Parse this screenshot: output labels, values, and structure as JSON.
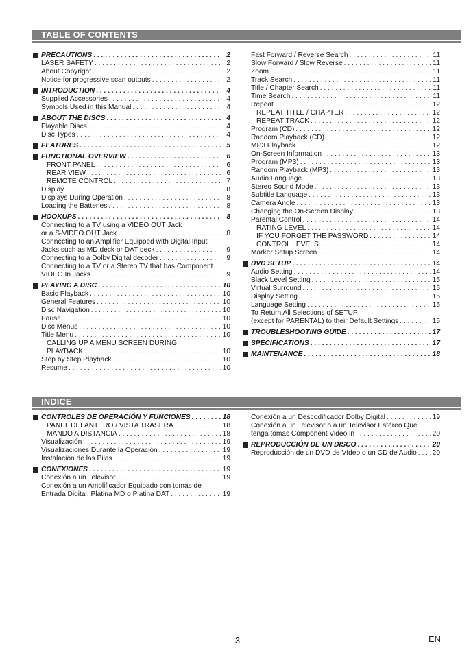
{
  "toc": {
    "heading": "TABLE OF CONTENTS",
    "left": [
      {
        "title": "PRECAUTIONS",
        "page": "2",
        "type": "head"
      },
      {
        "title": "LASER SAFETY",
        "page": "2",
        "type": "item"
      },
      {
        "title": "About Copyright",
        "page": "2",
        "type": "item"
      },
      {
        "title": "Notice for progressive scan outputs",
        "page": "2",
        "type": "item"
      },
      {
        "title": "INTRODUCTION",
        "page": "4",
        "type": "head"
      },
      {
        "title": "Supplied Accessories",
        "page": "4",
        "type": "item"
      },
      {
        "title": "Symbols Used in this Manual",
        "page": "4",
        "type": "item"
      },
      {
        "title": "ABOUT THE DISCS",
        "page": "4",
        "type": "head"
      },
      {
        "title": "Playable Discs",
        "page": "4",
        "type": "item"
      },
      {
        "title": "Disc Types",
        "page": "4",
        "type": "item"
      },
      {
        "title": "FEATURES",
        "page": "5",
        "type": "head"
      },
      {
        "title": "FUNCTIONAL OVERVIEW",
        "page": "6",
        "type": "head"
      },
      {
        "title": "FRONT PANEL",
        "page": "6",
        "type": "sub"
      },
      {
        "title": "REAR VIEW",
        "page": "6",
        "type": "sub"
      },
      {
        "title": "REMOTE CONTROL",
        "page": "7",
        "type": "sub"
      },
      {
        "title": "Display",
        "page": "8",
        "type": "item"
      },
      {
        "title": "Displays During Operation",
        "page": "8",
        "type": "item"
      },
      {
        "title": "Loading the Batteries",
        "page": "8",
        "type": "item"
      },
      {
        "title": "HOOKUPS",
        "page": "8",
        "type": "head"
      },
      {
        "title": "Connecting to a TV using a VIDEO OUT Jack",
        "page": "",
        "type": "wrap"
      },
      {
        "title": "or a S-VIDEO OUT Jack",
        "page": "8",
        "type": "item"
      },
      {
        "title": "Connecting to an Amplifier Equipped with Digital Input",
        "page": "",
        "type": "wrap"
      },
      {
        "title": "Jacks such as MD deck or DAT deck",
        "page": "9",
        "type": "item"
      },
      {
        "title": "Connecting to a Dolby Digital decoder",
        "page": "9",
        "type": "item"
      },
      {
        "title": "Connecting to a TV or a Stereo TV that has Component",
        "page": "",
        "type": "wrap"
      },
      {
        "title": "VIDEO In Jacks",
        "page": "9",
        "type": "item"
      },
      {
        "title": "PLAYING A DISC",
        "page": "10",
        "type": "head"
      },
      {
        "title": "Basic Playback",
        "page": "10",
        "type": "item"
      },
      {
        "title": "General Features",
        "page": "10",
        "type": "item"
      },
      {
        "title": "Disc Navigation",
        "page": "10",
        "type": "item"
      },
      {
        "title": "Pause",
        "page": "10",
        "type": "item"
      },
      {
        "title": "Disc Menus",
        "page": "10",
        "type": "item"
      },
      {
        "title": "Title Menu",
        "page": "10",
        "type": "item"
      },
      {
        "title": "CALLING UP A MENU SCREEN DURING",
        "page": "",
        "type": "subwrap"
      },
      {
        "title": "PLAYBACK",
        "page": "10",
        "type": "sub"
      },
      {
        "title": "Step by Step Playback",
        "page": "10",
        "type": "item"
      },
      {
        "title": "Resume",
        "page": "10",
        "type": "item"
      }
    ],
    "right": [
      {
        "title": "Fast Forward / Reverse Search",
        "page": "11",
        "type": "item"
      },
      {
        "title": "Slow Forward / Slow Reverse",
        "page": "11",
        "type": "item"
      },
      {
        "title": "Zoom",
        "page": "11",
        "type": "item"
      },
      {
        "title": "Track Search",
        "page": "11",
        "type": "item"
      },
      {
        "title": "Title / Chapter Search",
        "page": "11",
        "type": "item"
      },
      {
        "title": "Time Search",
        "page": "11",
        "type": "item"
      },
      {
        "title": "Repeat",
        "page": "12",
        "type": "item"
      },
      {
        "title": "REPEAT TITLE / CHAPTER",
        "page": "12",
        "type": "sub"
      },
      {
        "title": "REPEAT TRACK",
        "page": "12",
        "type": "sub"
      },
      {
        "title": "Program (CD)",
        "page": "12",
        "type": "item"
      },
      {
        "title": "Random Playback (CD)",
        "page": "12",
        "type": "item"
      },
      {
        "title": "MP3 Playback",
        "page": "12",
        "type": "item"
      },
      {
        "title": "On-Screen Information",
        "page": "13",
        "type": "item"
      },
      {
        "title": "Program (MP3)",
        "page": "13",
        "type": "item"
      },
      {
        "title": "Random Playback (MP3)",
        "page": "13",
        "type": "item"
      },
      {
        "title": "Audio Language",
        "page": "13",
        "type": "item"
      },
      {
        "title": "Stereo Sound Mode",
        "page": "13",
        "type": "item"
      },
      {
        "title": "Subtitle Language",
        "page": "13",
        "type": "item"
      },
      {
        "title": "Camera Angle",
        "page": "13",
        "type": "item"
      },
      {
        "title": "Changing the On-Screen Display",
        "page": "13",
        "type": "item"
      },
      {
        "title": "Parental Control",
        "page": "14",
        "type": "item"
      },
      {
        "title": "RATING LEVEL",
        "page": "14",
        "type": "sub"
      },
      {
        "title": "IF YOU FORGET THE PASSWORD",
        "page": "14",
        "type": "sub"
      },
      {
        "title": "CONTROL LEVELS",
        "page": "14",
        "type": "sub"
      },
      {
        "title": "Marker Setup Screen",
        "page": "14",
        "type": "item"
      },
      {
        "title": "DVD SETUP",
        "page": "14",
        "type": "head-plainpage"
      },
      {
        "title": "Audio Setting",
        "page": "14",
        "type": "item"
      },
      {
        "title": "Black Level Setting",
        "page": "15",
        "type": "item"
      },
      {
        "title": "Virtual Surround",
        "page": "15",
        "type": "item"
      },
      {
        "title": "Display Setting",
        "page": "15",
        "type": "item"
      },
      {
        "title": "Language Setting",
        "page": "15",
        "type": "item"
      },
      {
        "title": "To Return All Selections of SETUP",
        "page": "",
        "type": "wrap"
      },
      {
        "title": "(except for PARENTAL) to their Default Settings",
        "page": "15",
        "type": "item"
      },
      {
        "title": "TROUBLESHOOTING GUIDE",
        "page": "17",
        "type": "head"
      },
      {
        "title": "SPECIFICATIONS",
        "page": "17",
        "type": "head"
      },
      {
        "title": "MAINTENANCE",
        "page": "18",
        "type": "head"
      }
    ]
  },
  "indice": {
    "heading": "INDICE",
    "left": [
      {
        "title": "CONTROLES DE OPERACIÓN Y FUNCIONES",
        "page": "18",
        "type": "head"
      },
      {
        "title": "PANEL DELANTERO / VISTA TRASERA",
        "page": "18",
        "type": "sub"
      },
      {
        "title": "MANDO A DISTANCIA",
        "page": "18",
        "type": "sub"
      },
      {
        "title": "Visualización",
        "page": "19",
        "type": "item"
      },
      {
        "title": "Visualizaciones Durante la Operación",
        "page": "19",
        "type": "item"
      },
      {
        "title": "Instalación de las Pilas",
        "page": "19",
        "type": "item"
      },
      {
        "title": "CONEXIONES",
        "page": "19",
        "type": "head-plainpage"
      },
      {
        "title": "Conexión a un Televisor",
        "page": "19",
        "type": "item"
      },
      {
        "title": "Conexión a un Amplificador Equipado con tomas de",
        "page": "",
        "type": "wrap"
      },
      {
        "title": "Entrada Digital, Platina MD o Platina DAT",
        "page": "19",
        "type": "item"
      }
    ],
    "right": [
      {
        "title": "Conexión a un Descodificador Dolby Digital",
        "page": "19",
        "type": "item"
      },
      {
        "title": "Conexión a un Televisor o a un Televisor Estéreo Que",
        "page": "",
        "type": "wrap"
      },
      {
        "title": "tenga tomas Component Video in",
        "page": "20",
        "type": "item"
      },
      {
        "title": "REPRODUCCIÓN DE UN DISCO",
        "page": "20",
        "type": "head"
      },
      {
        "title": "Reproducción de un DVD de Vídeo o un CD de Audio",
        "page": "20",
        "type": "item"
      }
    ]
  },
  "footer": {
    "page_number": "– 3 –",
    "language": "EN"
  },
  "colors": {
    "section_bar": "#7f7f7f",
    "bar_text": "#ffffff",
    "text": "#1a1a1a"
  }
}
